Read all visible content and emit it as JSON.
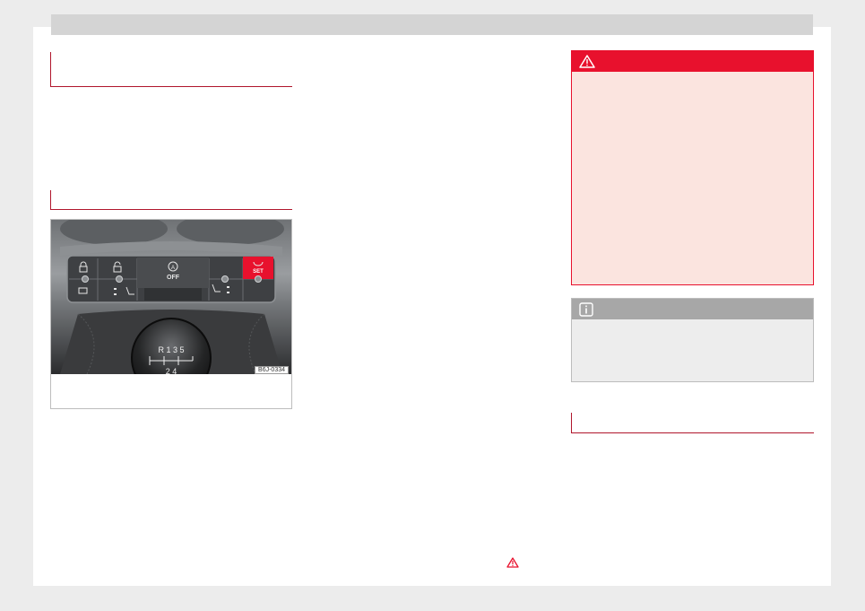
{
  "page": {
    "colors": {
      "accent_red": "#e8112d",
      "rule_red": "#b0162c",
      "warning_bg": "#fbe4df",
      "note_header": "#a7a7a7",
      "note_bg": "#ededed"
    }
  },
  "figure": {
    "code": "B6J-0334",
    "icons": [
      "lock-icon",
      "unlock-icon",
      "start-stop-off-icon",
      "seat-heating-icon",
      "tyre-pressure-set-icon",
      "gear-knob-icon"
    ],
    "button_labels": {
      "start_stop": "OFF",
      "tyre_pressure": "SET"
    },
    "gear_knob": {
      "top_row": "R  1  3  5",
      "bottom_row": "2  4"
    }
  },
  "warning_box": {
    "icon": "warning-triangle-icon"
  },
  "note_box": {
    "icon": "info-icon"
  },
  "footer": {
    "icon": "warning-triangle-icon"
  }
}
